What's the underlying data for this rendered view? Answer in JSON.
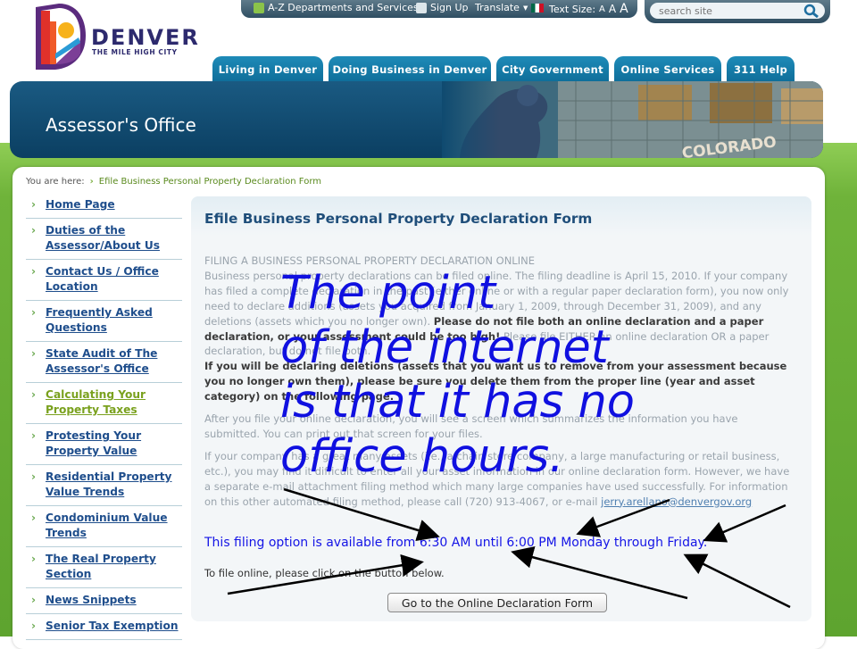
{
  "logo": {
    "word": "DENVER",
    "tagline": "THE MILE HIGH CITY"
  },
  "utility": {
    "az_departments": "A-Z Departments and Services",
    "sign_up": "Sign Up",
    "translate": "Translate",
    "text_size_label": "Text Size:",
    "text_size_small": "A",
    "text_size_medium": "A",
    "text_size_large": "A"
  },
  "search": {
    "placeholder": "search site"
  },
  "nav": {
    "tabs": [
      {
        "label": "Living in Denver"
      },
      {
        "label": "Doing Business in Denver"
      },
      {
        "label": "City Government"
      },
      {
        "label": "Online Services"
      },
      {
        "label": "311 Help"
      }
    ]
  },
  "banner": {
    "title": "Assessor's Office",
    "photo_sign": "COLORADO"
  },
  "breadcrumb": {
    "prefix": "You are here:",
    "current": "Efile Business Personal Property Declaration Form"
  },
  "sidebar": {
    "items": [
      {
        "label": "Home Page"
      },
      {
        "label": "Duties of the Assessor/About Us"
      },
      {
        "label": "Contact Us / Office Location"
      },
      {
        "label": "Frequently Asked Questions"
      },
      {
        "label": "State Audit of The Assessor's Office"
      },
      {
        "label": "Calculating Your Property Taxes"
      },
      {
        "label": "Protesting Your Property Value"
      },
      {
        "label": "Residential Property Value Trends"
      },
      {
        "label": "Condominium Value Trends"
      },
      {
        "label": "The Real Property Section"
      },
      {
        "label": "News Snippets"
      },
      {
        "label": "Senior Tax Exemption"
      }
    ]
  },
  "main": {
    "title": "Efile Business Personal Property Declaration Form",
    "heading": "FILING A BUSINESS PERSONAL PROPERTY DECLARATION ONLINE",
    "para1": "Business personal property declarations can be filed online. The filing deadline is April 15, 2010. If your company has filed a complete declaration in the past (either online or with a regular paper declaration form), you now only need to declare additions (assets you acquired from January 1, 2009, through December 31, 2009), and any deletions (assets which you no longer own).",
    "para1_bold": "Please do not file both an online declaration and a paper declaration, or your assessment could be too high!",
    "para1_tail": "Please file EITHER an online declaration OR a paper declaration, but do not file both.",
    "para2_bold": "If you will be declaring deletions (assets that you want us to remove from your assessment because you no longer own them), please be sure you delete them from the proper line (year and asset category) on the following page.",
    "para3": "After you file your online declaration, you will see a screen which summarizes the information you have submitted. You can print out that screen for your files.",
    "para4": "If your company has a great many assets (i.e., a chain store company, a large manufacturing or retail business, etc.), you may find it difficult to enter all your asset information in our online declaration form. However, we have a separate e-mail attachment filing method which many large companies have used successfully. For information on this other automated filing method, please call (720) 913-4067, or e-mail",
    "email": "jerry.arellano@denvergov.org",
    "notice": "This filing option is available from 6:30 AM until 6:00 PM Monday through Friday.",
    "instruction": "To file online, please click on the button below.",
    "button": "Go to the Online Declaration Form"
  },
  "overlay": {
    "lines": [
      "The point",
      "of the internet",
      "is that it has no",
      "office hours."
    ]
  },
  "colors": {
    "nav_tab": "#1280ad",
    "link": "#1f4e8c",
    "notice": "#1414e6",
    "overlay_text": "#1010e0"
  }
}
